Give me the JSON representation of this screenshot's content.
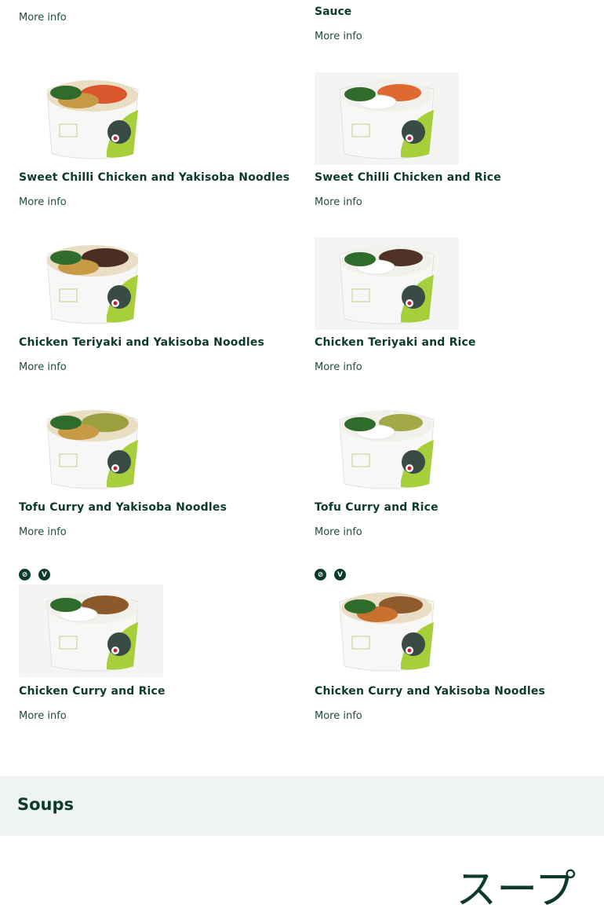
{
  "top_partial": {
    "left_more": "More info",
    "right_title": "Sauce",
    "right_more": "More info"
  },
  "items": [
    {
      "title": "Sweet Chilli Chicken and Yakisoba Noodles",
      "more": "More info",
      "topping": "#d9572c",
      "base": "noodles"
    },
    {
      "title": "Sweet Chilli Chicken and Rice",
      "more": "More info",
      "topping": "#de6a32",
      "base": "rice"
    },
    {
      "title": "Chicken Teriyaki and Yakisoba Noodles",
      "more": "More info",
      "topping": "#4a2e22",
      "base": "noodles"
    },
    {
      "title": "Chicken Teriyaki and Rice",
      "more": "More info",
      "topping": "#4f3326",
      "base": "rice"
    },
    {
      "title": "Tofu Curry and Yakisoba Noodles",
      "more": "More info",
      "topping": "#9aa040",
      "base": "noodles"
    },
    {
      "title": "Tofu Curry and Rice",
      "more": "More info",
      "topping": "#a3a848",
      "base": "rice"
    },
    {
      "title": "Chicken Curry and Rice",
      "more": "More info",
      "topping": "#8a5a2a",
      "base": "rice",
      "badges": [
        "leaf-icon",
        "vegetarian-icon"
      ]
    },
    {
      "title": "Chicken Curry and Yakisoba Noodles",
      "more": "More info",
      "topping": "#8f5b2c",
      "base": "noodles",
      "badges": [
        "leaf-icon",
        "vegetarian-icon"
      ]
    }
  ],
  "badges": {
    "leaf": "⊘",
    "vegetarian": "V"
  },
  "section": {
    "title": "Soups",
    "jp_title": "スープ"
  },
  "colors": {
    "brand_green": "#0c3a2c",
    "accent_lime": "#a6cf3b",
    "section_bg": "#eff3f2"
  }
}
